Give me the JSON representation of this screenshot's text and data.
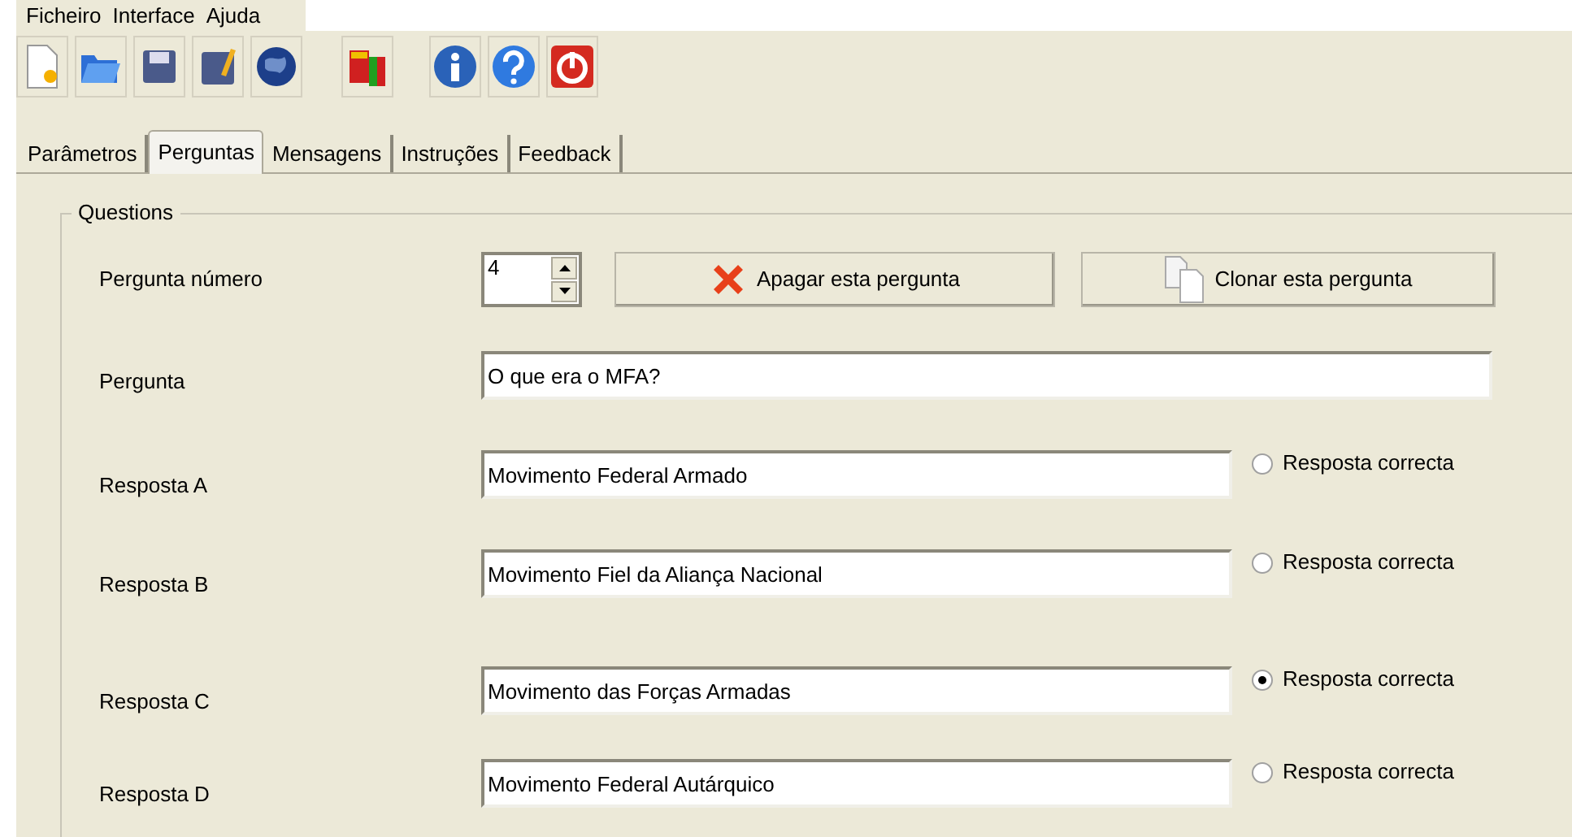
{
  "menu": [
    "Ficheiro",
    "Interface",
    "Ajuda"
  ],
  "tabs": [
    {
      "label": "Parâmetros",
      "selected": false
    },
    {
      "label": "Perguntas",
      "selected": true
    },
    {
      "label": "Mensagens",
      "selected": false
    },
    {
      "label": "Instruções",
      "selected": false
    },
    {
      "label": "Feedback",
      "selected": false
    }
  ],
  "group": {
    "title": "Questions",
    "number": {
      "label": "Pergunta número",
      "value": "4"
    },
    "delete_button": "Apagar esta pergunta",
    "clone_button": "Clonar esta pergunta",
    "question": {
      "label": "Pergunta",
      "value": "O que era o MFA?"
    },
    "answers": [
      {
        "label": "Resposta A",
        "value": "Movimento Federal Armado",
        "radio_label": "Resposta correcta",
        "selected": false
      },
      {
        "label": "Resposta B",
        "value": "Movimento Fiel da Aliança Nacional",
        "radio_label": "Resposta correcta",
        "selected": false
      },
      {
        "label": "Resposta C",
        "value": "Movimento das Forças Armadas",
        "radio_label": "Resposta correcta",
        "selected": true
      },
      {
        "label": "Resposta D",
        "value": "Movimento Federal Autárquico",
        "radio_label": "Resposta correcta",
        "selected": false
      }
    ]
  }
}
